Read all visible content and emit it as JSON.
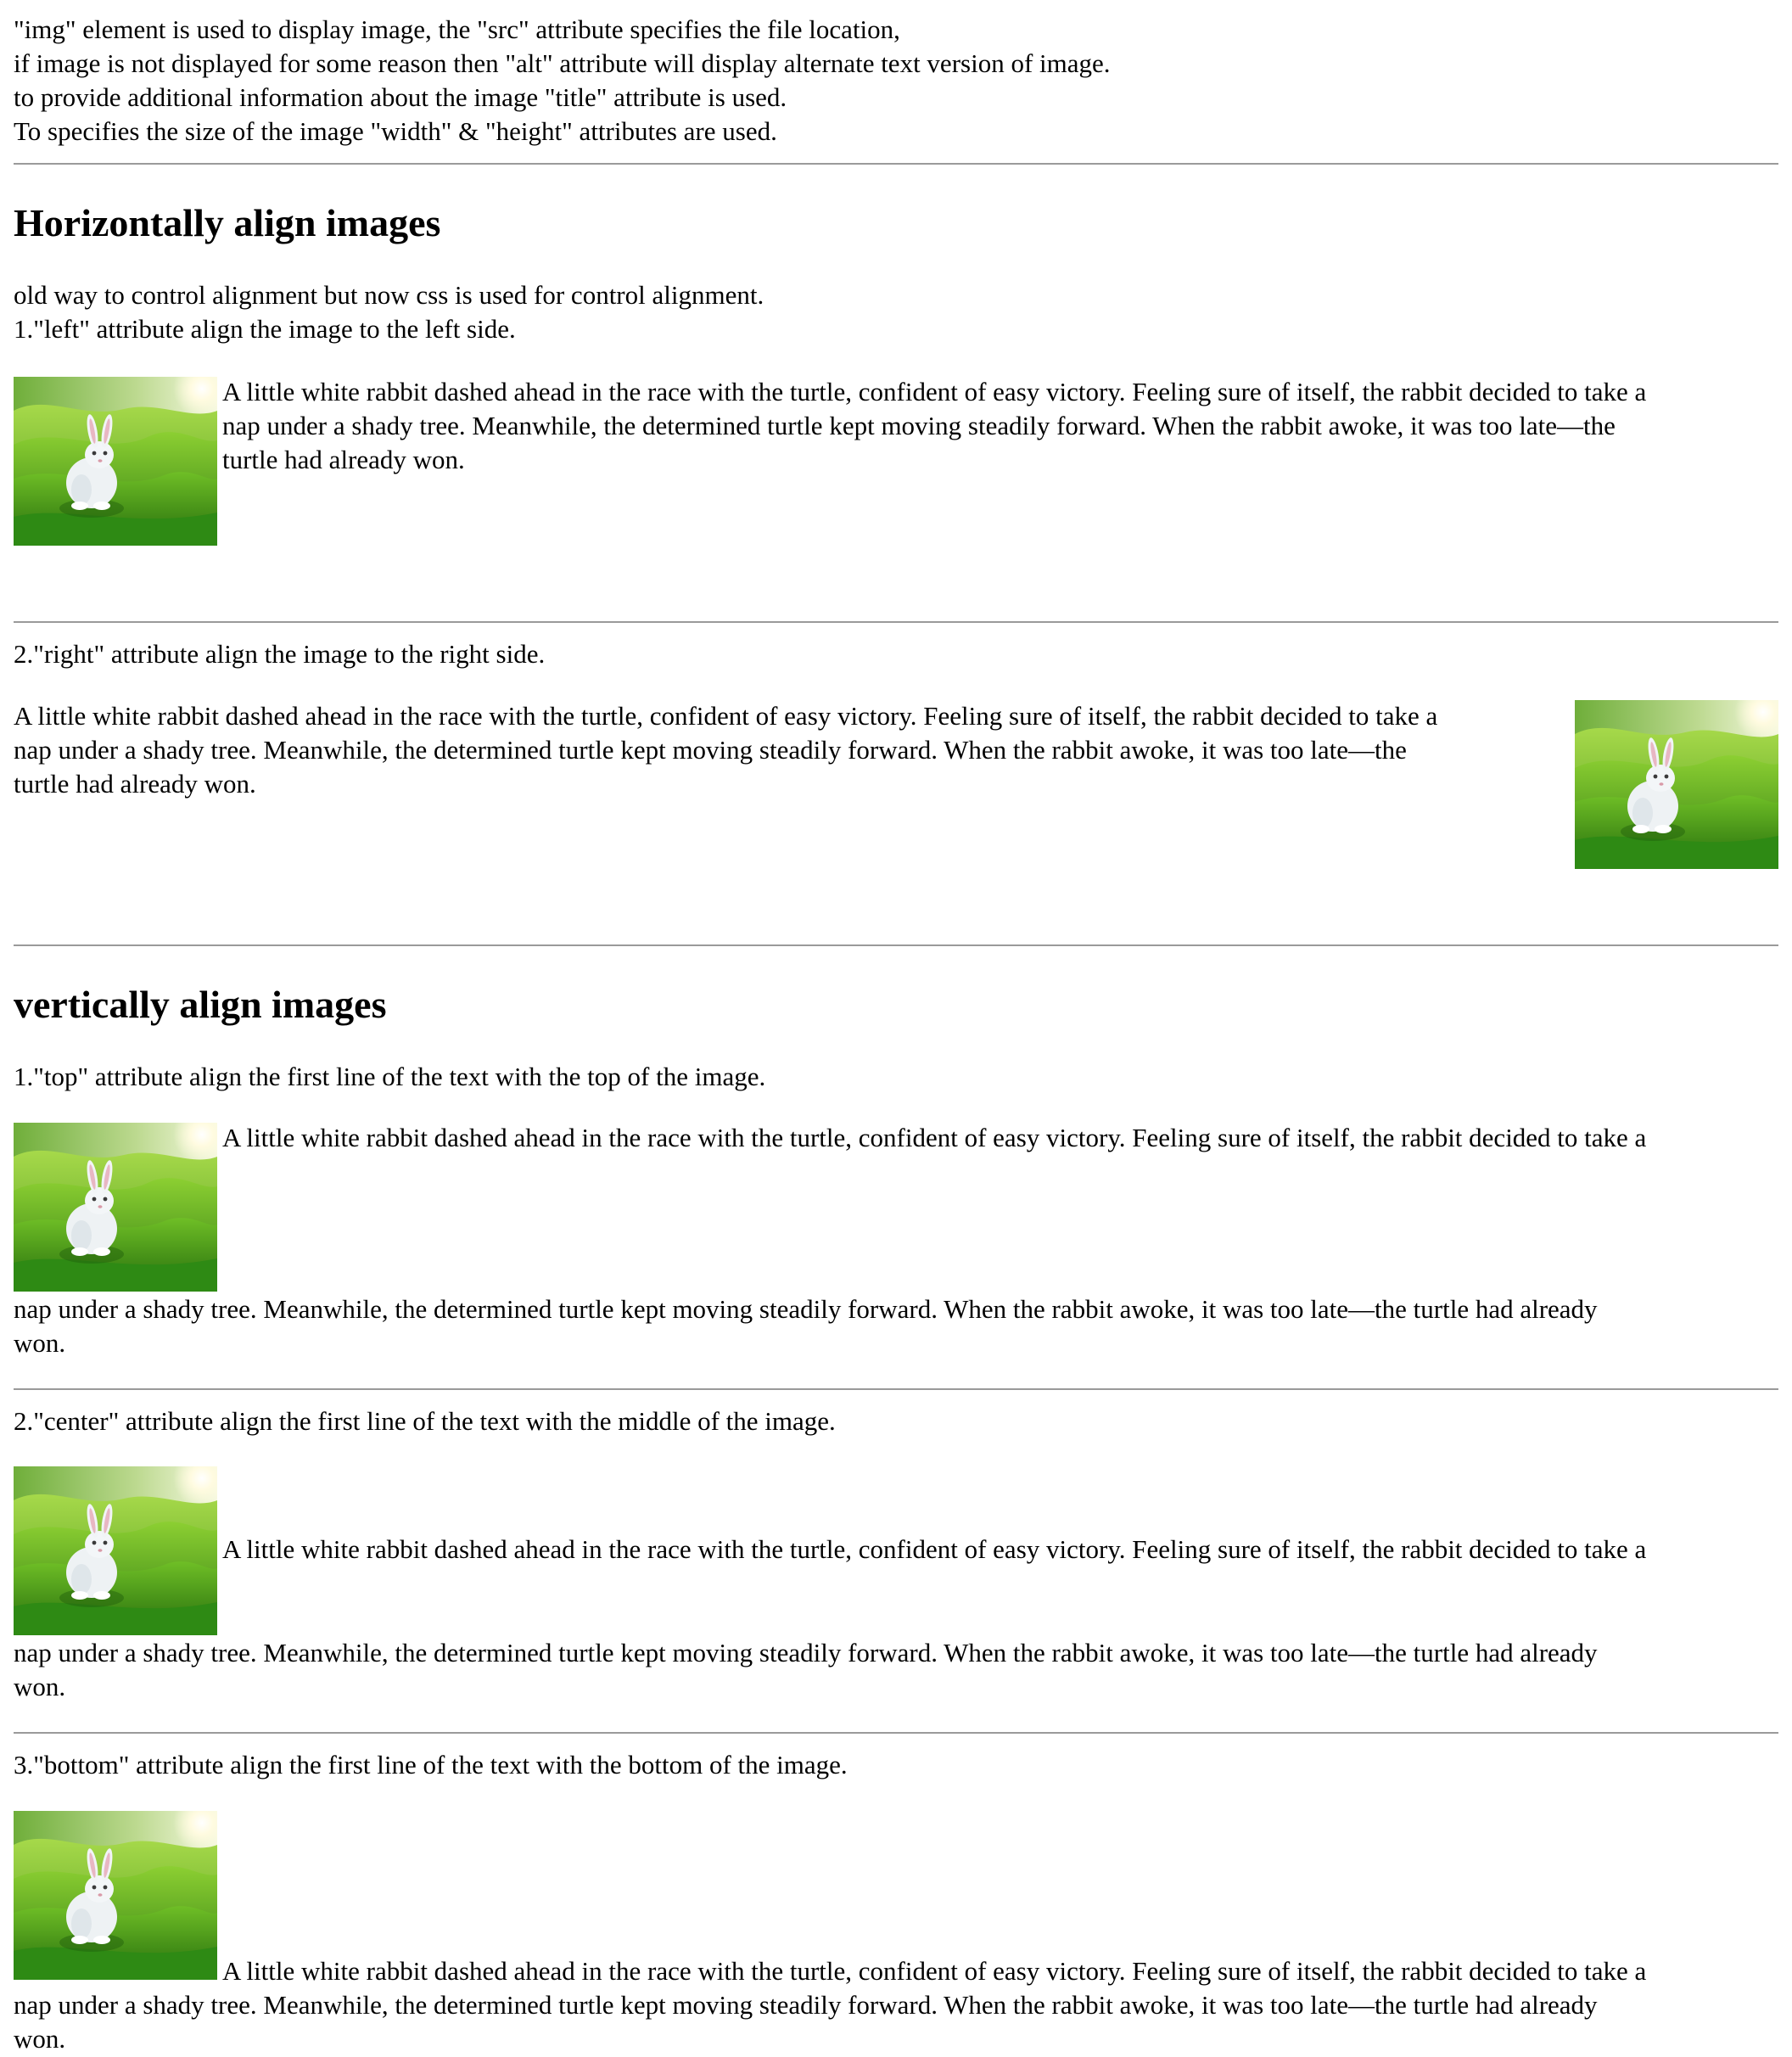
{
  "intro": {
    "lines": [
      "\"img\" element is used to display image, the \"src\" attribute specifies the file location,",
      "if image is not displayed for some reason then \"alt\" attribute will display alternate text version of image.",
      "to provide additional information about the image \"title\" attribute is used.",
      "To specifies the size of the image \"width\" & \"height\" attributes are used."
    ]
  },
  "horizontal": {
    "heading": "Horizontally align images",
    "description": "old way to control alignment but now css is used for control alignment.",
    "left": {
      "caption": "1.\"left\" attribute align the image to the left side.",
      "lines": [
        "A little white rabbit dashed ahead in the race with the turtle, confident of easy victory. Feeling sure of itself, the rabbit decided to take a",
        "nap under a shady tree. Meanwhile, the determined turtle kept moving steadily forward. When the rabbit awoke, it was too late—the",
        "turtle had already won."
      ]
    },
    "right": {
      "caption": "2.\"right\" attribute align the image to the right side.",
      "lines": [
        "A little white rabbit dashed ahead in the race with the turtle, confident of easy victory. Feeling sure of itself, the rabbit decided to take a",
        "nap under a shady tree. Meanwhile, the determined turtle kept moving steadily forward. When the rabbit awoke, it was too late—the",
        "turtle had already won."
      ]
    }
  },
  "vertical": {
    "heading": "vertically align images",
    "top": {
      "caption": "1.\"top\" attribute align the first line of the text with the top of the image.",
      "first_line": "A little white rabbit dashed ahead in the race with the turtle, confident of easy victory. Feeling sure of itself, the rabbit decided to take a",
      "rest_lines": [
        "nap under a shady tree. Meanwhile, the determined turtle kept moving steadily forward. When the rabbit awoke, it was too late—the turtle had already",
        "won."
      ]
    },
    "center": {
      "caption": "2.\"center\" attribute align the first line of the text with the middle of the image.",
      "first_line": "A little white rabbit dashed ahead in the race with the turtle, confident of easy victory. Feeling sure of itself, the rabbit decided to take a",
      "rest_lines": [
        "nap under a shady tree. Meanwhile, the determined turtle kept moving steadily forward. When the rabbit awoke, it was too late—the turtle had already",
        "won."
      ]
    },
    "bottom": {
      "caption": "3.\"bottom\" attribute align the first line of the text with the bottom of the image.",
      "first_line": "A little white rabbit dashed ahead in the race with the turtle, confident of easy victory. Feeling sure of itself, the rabbit decided to take a",
      "rest_lines": [
        "nap under a shady tree. Meanwhile, the determined turtle kept moving steadily forward. When the rabbit awoke, it was too late—the turtle had already",
        "won."
      ]
    }
  },
  "image": {
    "subject": "white rabbit on green hills"
  },
  "colors": {
    "rule": "#9a9a9a",
    "text": "#000000",
    "background": "#ffffff"
  }
}
